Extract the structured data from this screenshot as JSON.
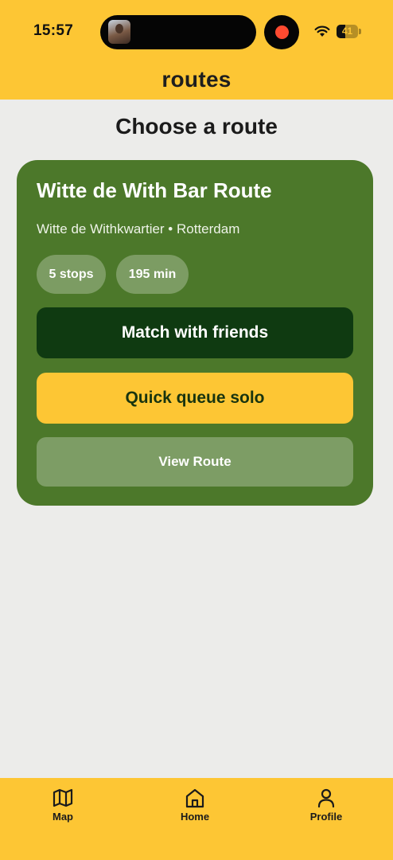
{
  "status_bar": {
    "time": "15:57",
    "battery_level": "41",
    "battery_fraction": 0.41
  },
  "header": {
    "app_title": "routes"
  },
  "page": {
    "title": "Choose a route"
  },
  "route_card": {
    "name": "Witte de With Bar Route",
    "location": "Witte de Withkwartier • Rotterdam",
    "stops_chip": "5 stops",
    "duration_chip": "195 min",
    "match_button": "Match with friends",
    "solo_button": "Quick queue solo",
    "view_button": "View Route"
  },
  "tab_bar": {
    "tabs": [
      {
        "label": "Map",
        "icon": "map-icon"
      },
      {
        "label": "Home",
        "icon": "home-icon"
      },
      {
        "label": "Profile",
        "icon": "person-icon"
      }
    ]
  },
  "colors": {
    "brand_yellow": "#fdc634",
    "card_green": "#4c782a",
    "dark_green": "#0f3a11",
    "background": "#ececea"
  }
}
